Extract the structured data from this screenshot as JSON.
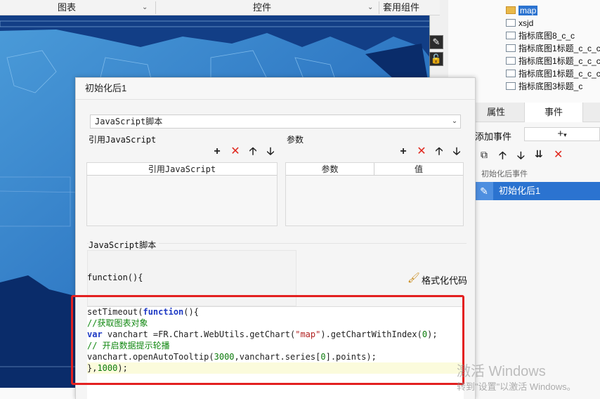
{
  "toolbar": {
    "chart": "图表",
    "controls": "控件",
    "components": "套用组件"
  },
  "tree": {
    "items": [
      {
        "label": "map",
        "selected": true
      },
      {
        "label": "xsjd"
      },
      {
        "label": "指标底图8_c_c"
      },
      {
        "label": "指标底图1标题_c_c_c"
      },
      {
        "label": "指标底图1标题_c_c_c"
      },
      {
        "label": "指标底图1标题_c_c_c"
      },
      {
        "label": "指标底图3标题_c"
      }
    ]
  },
  "right_panel": {
    "tab_properties": "属性",
    "tab_events": "事件",
    "add_event_label": "添加事件",
    "section_label": "初始化后事件",
    "event_item": "初始化后1"
  },
  "dialog": {
    "title": "初始化后1",
    "type_select": "JavaScript脚本",
    "ref_js_label": "引用JavaScript",
    "params_label": "参数",
    "ref_js_header": "引用JavaScript",
    "param_header": "参数",
    "value_header": "值",
    "script_label": "JavaScript脚本",
    "function_label": "function(){",
    "format_code": "格式化代码"
  },
  "code": {
    "lines": [
      "setTimeout(function(){",
      "//获取图表对象",
      "var vanchart =FR.Chart.WebUtils.getChart(\"map\").getChartWithIndex(0);",
      "// 开启数据提示轮播",
      "vanchart.openAutoTooltip(3000,vanchart.series[0].points);",
      "},1000);"
    ]
  },
  "watermark": {
    "line1": "激活 Windows",
    "line2": "转到\"设置\"以激活 Windows。"
  },
  "colors": {
    "accent": "#2b73d0",
    "highlight_box": "#e32020",
    "map_bg": "#1c5ea8"
  }
}
